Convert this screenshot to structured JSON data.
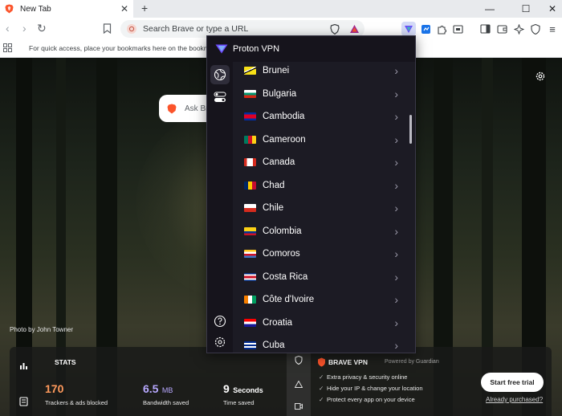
{
  "browser": {
    "tab_title": "New Tab",
    "new_tab_symbol": "+",
    "close_tab_symbol": "✕",
    "window_controls": [
      "—",
      "☐",
      "✕"
    ],
    "url_placeholder": "Search Brave or type a URL"
  },
  "bookmarks_bar": {
    "message": "For quick access, place your bookmarks here on the bookma"
  },
  "ntp": {
    "search_placeholder": "Ask Br",
    "photo_credit": "Photo by John Towner"
  },
  "stats": {
    "title": "STATS",
    "items": [
      {
        "value": "170",
        "unit": "",
        "label": "Trackers & ads blocked",
        "color": "#ff9a5c"
      },
      {
        "value": "6.5",
        "unit": "MB",
        "label": "Bandwidth saved",
        "color": "#b7a8ff"
      },
      {
        "value": "9",
        "unit": "Seconds",
        "label": "Time saved",
        "color": "#ffffff"
      }
    ]
  },
  "brave_vpn": {
    "title": "BRAVE VPN",
    "powered_by": "Powered by  Guardian",
    "features": [
      "Extra privacy & security online",
      "Hide your IP & change your location",
      "Protect every app on your device"
    ],
    "cta": "Start free trial",
    "already": "Already purchased?"
  },
  "proton": {
    "title": "Proton VPN",
    "countries": [
      {
        "name": "Brunei",
        "flag": "brunei"
      },
      {
        "name": "Bulgaria",
        "flag": "bulgaria"
      },
      {
        "name": "Cambodia",
        "flag": "cambodia"
      },
      {
        "name": "Cameroon",
        "flag": "cameroon"
      },
      {
        "name": "Canada",
        "flag": "canada"
      },
      {
        "name": "Chad",
        "flag": "chad"
      },
      {
        "name": "Chile",
        "flag": "chile"
      },
      {
        "name": "Colombia",
        "flag": "colombia"
      },
      {
        "name": "Comoros",
        "flag": "comoros"
      },
      {
        "name": "Costa Rica",
        "flag": "costa-rica"
      },
      {
        "name": "Côte d'Ivoire",
        "flag": "cote-divoire"
      },
      {
        "name": "Croatia",
        "flag": "croatia"
      },
      {
        "name": "Cuba",
        "flag": "cuba"
      }
    ]
  },
  "colors": {
    "proton_bg": "#1c1b24",
    "proton_accent": "#6d4aff",
    "brave_orange": "#fb542b"
  }
}
